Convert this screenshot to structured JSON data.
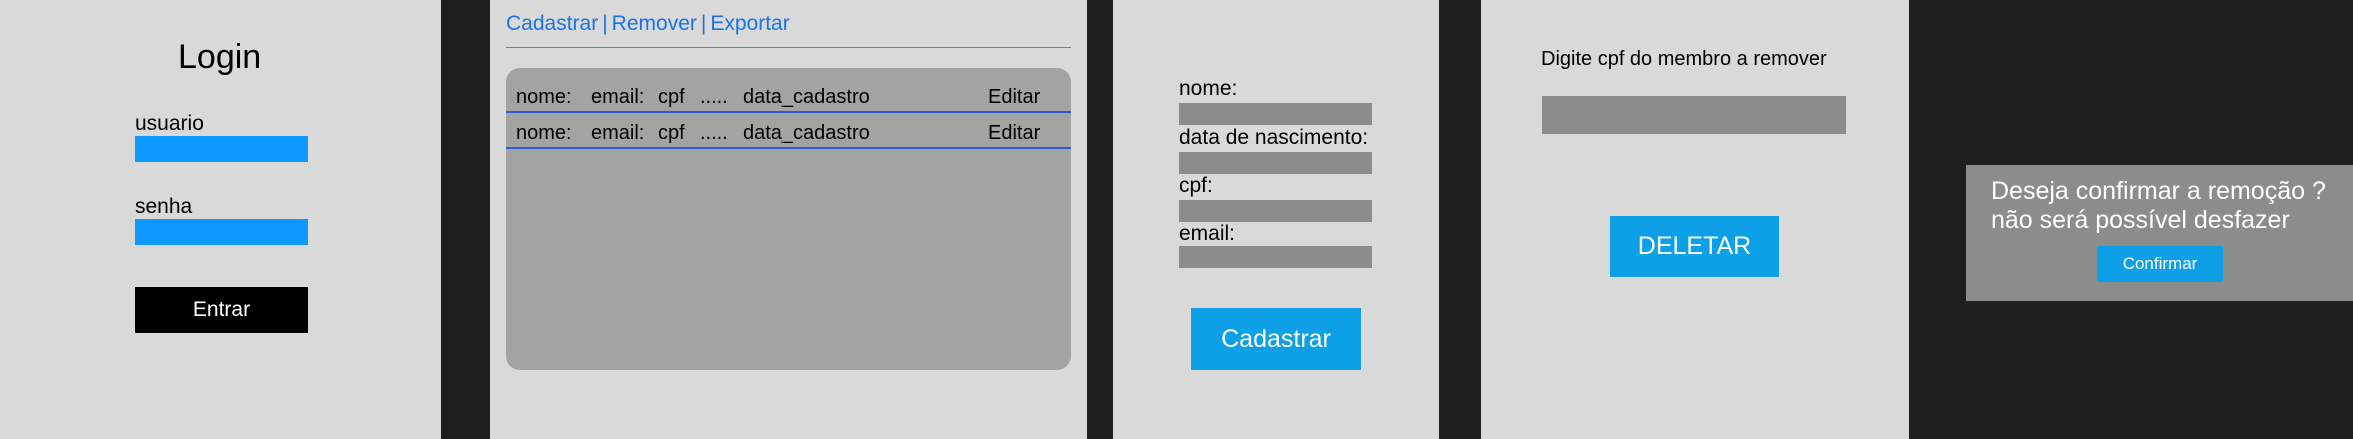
{
  "login": {
    "title": "Login",
    "username_label": "usuario",
    "password_label": "senha",
    "submit_label": "Entrar"
  },
  "list": {
    "nav": [
      "Cadastrar",
      "Remover",
      "Exportar"
    ],
    "rows": [
      {
        "nome": "nome:",
        "email": "email:",
        "cpf": "cpf",
        "more": ".....",
        "data": "data_cadastro",
        "action": "Editar"
      },
      {
        "nome": "nome:",
        "email": "email:",
        "cpf": "cpf",
        "more": ".....",
        "data": "data_cadastro",
        "action": "Editar"
      }
    ]
  },
  "form": {
    "name_label": "nome:",
    "birth_label": "data de nascimento:",
    "cpf_label": "cpf:",
    "email_label": "email:",
    "submit_label": "Cadastrar"
  },
  "remove": {
    "prompt": "Digite cpf do membro a remover",
    "delete_label": "DELETAR"
  },
  "dialog": {
    "message_line1": "Deseja confirmar a remoção ?",
    "message_line2": "não será possível desfazer",
    "confirm_label": "Confirmar"
  },
  "colors": {
    "accent_blue": "#0d99ff",
    "link_blue": "#1a73e8",
    "panel_bg": "#d9d9d9",
    "background": "#1e1e1e"
  }
}
